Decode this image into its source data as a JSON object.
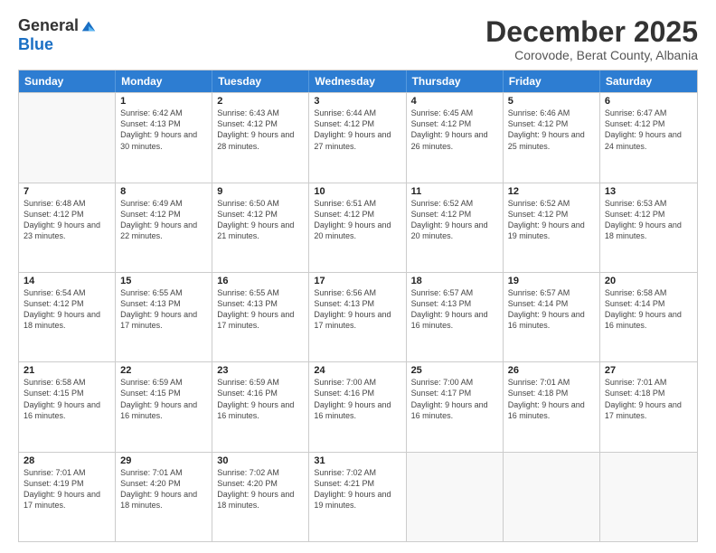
{
  "logo": {
    "general": "General",
    "blue": "Blue"
  },
  "title": "December 2025",
  "subtitle": "Corovode, Berat County, Albania",
  "header_days": [
    "Sunday",
    "Monday",
    "Tuesday",
    "Wednesday",
    "Thursday",
    "Friday",
    "Saturday"
  ],
  "weeks": [
    [
      {
        "day": "",
        "sunrise": "",
        "sunset": "",
        "daylight": ""
      },
      {
        "day": "1",
        "sunrise": "Sunrise: 6:42 AM",
        "sunset": "Sunset: 4:13 PM",
        "daylight": "Daylight: 9 hours and 30 minutes."
      },
      {
        "day": "2",
        "sunrise": "Sunrise: 6:43 AM",
        "sunset": "Sunset: 4:12 PM",
        "daylight": "Daylight: 9 hours and 28 minutes."
      },
      {
        "day": "3",
        "sunrise": "Sunrise: 6:44 AM",
        "sunset": "Sunset: 4:12 PM",
        "daylight": "Daylight: 9 hours and 27 minutes."
      },
      {
        "day": "4",
        "sunrise": "Sunrise: 6:45 AM",
        "sunset": "Sunset: 4:12 PM",
        "daylight": "Daylight: 9 hours and 26 minutes."
      },
      {
        "day": "5",
        "sunrise": "Sunrise: 6:46 AM",
        "sunset": "Sunset: 4:12 PM",
        "daylight": "Daylight: 9 hours and 25 minutes."
      },
      {
        "day": "6",
        "sunrise": "Sunrise: 6:47 AM",
        "sunset": "Sunset: 4:12 PM",
        "daylight": "Daylight: 9 hours and 24 minutes."
      }
    ],
    [
      {
        "day": "7",
        "sunrise": "Sunrise: 6:48 AM",
        "sunset": "Sunset: 4:12 PM",
        "daylight": "Daylight: 9 hours and 23 minutes."
      },
      {
        "day": "8",
        "sunrise": "Sunrise: 6:49 AM",
        "sunset": "Sunset: 4:12 PM",
        "daylight": "Daylight: 9 hours and 22 minutes."
      },
      {
        "day": "9",
        "sunrise": "Sunrise: 6:50 AM",
        "sunset": "Sunset: 4:12 PM",
        "daylight": "Daylight: 9 hours and 21 minutes."
      },
      {
        "day": "10",
        "sunrise": "Sunrise: 6:51 AM",
        "sunset": "Sunset: 4:12 PM",
        "daylight": "Daylight: 9 hours and 20 minutes."
      },
      {
        "day": "11",
        "sunrise": "Sunrise: 6:52 AM",
        "sunset": "Sunset: 4:12 PM",
        "daylight": "Daylight: 9 hours and 20 minutes."
      },
      {
        "day": "12",
        "sunrise": "Sunrise: 6:52 AM",
        "sunset": "Sunset: 4:12 PM",
        "daylight": "Daylight: 9 hours and 19 minutes."
      },
      {
        "day": "13",
        "sunrise": "Sunrise: 6:53 AM",
        "sunset": "Sunset: 4:12 PM",
        "daylight": "Daylight: 9 hours and 18 minutes."
      }
    ],
    [
      {
        "day": "14",
        "sunrise": "Sunrise: 6:54 AM",
        "sunset": "Sunset: 4:12 PM",
        "daylight": "Daylight: 9 hours and 18 minutes."
      },
      {
        "day": "15",
        "sunrise": "Sunrise: 6:55 AM",
        "sunset": "Sunset: 4:13 PM",
        "daylight": "Daylight: 9 hours and 17 minutes."
      },
      {
        "day": "16",
        "sunrise": "Sunrise: 6:55 AM",
        "sunset": "Sunset: 4:13 PM",
        "daylight": "Daylight: 9 hours and 17 minutes."
      },
      {
        "day": "17",
        "sunrise": "Sunrise: 6:56 AM",
        "sunset": "Sunset: 4:13 PM",
        "daylight": "Daylight: 9 hours and 17 minutes."
      },
      {
        "day": "18",
        "sunrise": "Sunrise: 6:57 AM",
        "sunset": "Sunset: 4:13 PM",
        "daylight": "Daylight: 9 hours and 16 minutes."
      },
      {
        "day": "19",
        "sunrise": "Sunrise: 6:57 AM",
        "sunset": "Sunset: 4:14 PM",
        "daylight": "Daylight: 9 hours and 16 minutes."
      },
      {
        "day": "20",
        "sunrise": "Sunrise: 6:58 AM",
        "sunset": "Sunset: 4:14 PM",
        "daylight": "Daylight: 9 hours and 16 minutes."
      }
    ],
    [
      {
        "day": "21",
        "sunrise": "Sunrise: 6:58 AM",
        "sunset": "Sunset: 4:15 PM",
        "daylight": "Daylight: 9 hours and 16 minutes."
      },
      {
        "day": "22",
        "sunrise": "Sunrise: 6:59 AM",
        "sunset": "Sunset: 4:15 PM",
        "daylight": "Daylight: 9 hours and 16 minutes."
      },
      {
        "day": "23",
        "sunrise": "Sunrise: 6:59 AM",
        "sunset": "Sunset: 4:16 PM",
        "daylight": "Daylight: 9 hours and 16 minutes."
      },
      {
        "day": "24",
        "sunrise": "Sunrise: 7:00 AM",
        "sunset": "Sunset: 4:16 PM",
        "daylight": "Daylight: 9 hours and 16 minutes."
      },
      {
        "day": "25",
        "sunrise": "Sunrise: 7:00 AM",
        "sunset": "Sunset: 4:17 PM",
        "daylight": "Daylight: 9 hours and 16 minutes."
      },
      {
        "day": "26",
        "sunrise": "Sunrise: 7:01 AM",
        "sunset": "Sunset: 4:18 PM",
        "daylight": "Daylight: 9 hours and 16 minutes."
      },
      {
        "day": "27",
        "sunrise": "Sunrise: 7:01 AM",
        "sunset": "Sunset: 4:18 PM",
        "daylight": "Daylight: 9 hours and 17 minutes."
      }
    ],
    [
      {
        "day": "28",
        "sunrise": "Sunrise: 7:01 AM",
        "sunset": "Sunset: 4:19 PM",
        "daylight": "Daylight: 9 hours and 17 minutes."
      },
      {
        "day": "29",
        "sunrise": "Sunrise: 7:01 AM",
        "sunset": "Sunset: 4:20 PM",
        "daylight": "Daylight: 9 hours and 18 minutes."
      },
      {
        "day": "30",
        "sunrise": "Sunrise: 7:02 AM",
        "sunset": "Sunset: 4:20 PM",
        "daylight": "Daylight: 9 hours and 18 minutes."
      },
      {
        "day": "31",
        "sunrise": "Sunrise: 7:02 AM",
        "sunset": "Sunset: 4:21 PM",
        "daylight": "Daylight: 9 hours and 19 minutes."
      },
      {
        "day": "",
        "sunrise": "",
        "sunset": "",
        "daylight": ""
      },
      {
        "day": "",
        "sunrise": "",
        "sunset": "",
        "daylight": ""
      },
      {
        "day": "",
        "sunrise": "",
        "sunset": "",
        "daylight": ""
      }
    ]
  ]
}
